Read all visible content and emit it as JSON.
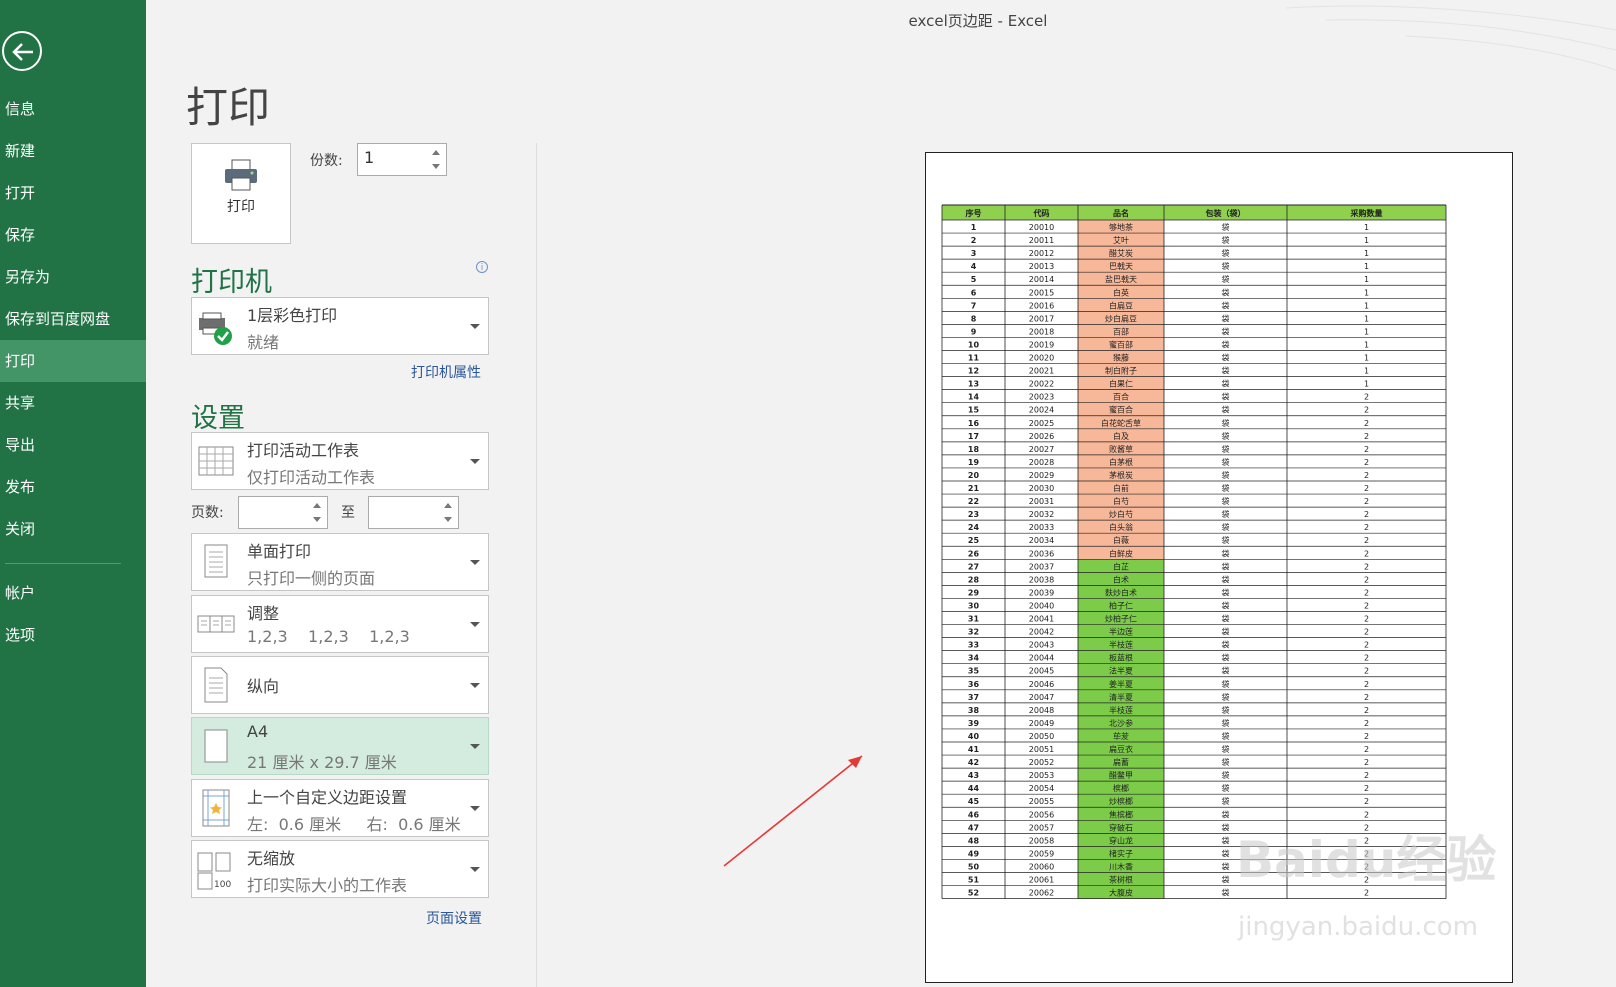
{
  "window": {
    "title": "excel页边距 - Excel"
  },
  "sidebar": {
    "items": [
      {
        "label": "信息"
      },
      {
        "label": "新建"
      },
      {
        "label": "打开"
      },
      {
        "label": "保存"
      },
      {
        "label": "另存为"
      },
      {
        "label": "保存到百度网盘"
      },
      {
        "label": "打印",
        "active": true
      },
      {
        "label": "共享"
      },
      {
        "label": "导出"
      },
      {
        "label": "发布"
      },
      {
        "label": "关闭"
      }
    ],
    "bottom_items": [
      {
        "label": "帐户"
      },
      {
        "label": "选项"
      }
    ]
  },
  "main": {
    "heading": "打印",
    "print_button": {
      "label": "打印"
    },
    "copies": {
      "label": "份数:",
      "value": "1"
    },
    "printer": {
      "section_title": "打印机",
      "name": "1层彩色打印",
      "status": "就绪",
      "properties_link": "打印机属性"
    },
    "settings": {
      "section_title": "设置",
      "options": [
        {
          "title": "打印活动工作表",
          "subtitle": "仅打印活动工作表"
        },
        {
          "title": "单面打印",
          "subtitle": "只打印一侧的页面"
        },
        {
          "title": "调整",
          "subtitle": "1,2,3    1,2,3    1,2,3"
        },
        {
          "title": "纵向",
          "subtitle": ""
        },
        {
          "title": "A4",
          "subtitle": "21 厘米 x 29.7 厘米",
          "highlighted": true
        },
        {
          "title": "上一个自定义边距设置",
          "subtitle": "左:  0.6 厘米     右:  0.6 厘米"
        },
        {
          "title": "无缩放",
          "subtitle": "打印实际大小的工作表"
        }
      ],
      "pages": {
        "label": "页数:",
        "to_label": "至",
        "from": "",
        "to": ""
      },
      "page_setup_link": "页面设置"
    }
  },
  "preview": {
    "headers": [
      "序号",
      "代码",
      "品名",
      "包装（袋）",
      "采购数量"
    ],
    "code_start": 20010,
    "names": [
      "够地茶",
      "艾叶",
      "醋艾炭",
      "巴戟天",
      "盐巴戟天",
      "白英",
      "白扁豆",
      "炒白扁豆",
      "百部",
      "蜜百部",
      "猴藤",
      "制白附子",
      "白果仁",
      "百合",
      "蜜百合",
      "白花蛇舌草",
      "白及",
      "败酱草",
      "白茅根",
      "茅根炭",
      "白前",
      "白芍",
      "炒白芍",
      "白头翁",
      "白薇",
      "白鲜皮",
      "白芷",
      "白术",
      "麸炒白术",
      "柏子仁",
      "炒柏子仁",
      "半边莲",
      "半枝莲",
      "板蓝根",
      "法半夏",
      "姜半夏",
      "清半夏",
      "半枝莲",
      "北沙参",
      "荜茇",
      "扁豆衣",
      "扁蓄",
      "醋鳖甲",
      "槟榔",
      "炒槟榔",
      "焦槟榔",
      "穿破石",
      "穿山龙",
      "楮实子",
      "川木香",
      "茶树根",
      "大腹皮"
    ],
    "codes_extra": [
      "20061"
    ],
    "package": "袋",
    "qty_ones": 13,
    "watermark": "Baidu经验",
    "watermark_url": "jingyan.baidu.com",
    "colors": {
      "header": "#8fd14f",
      "salmon": "#f7b89a",
      "green": "#7ccc4a",
      "sidebar": "#217346",
      "sidebar_active": "#439467"
    }
  }
}
